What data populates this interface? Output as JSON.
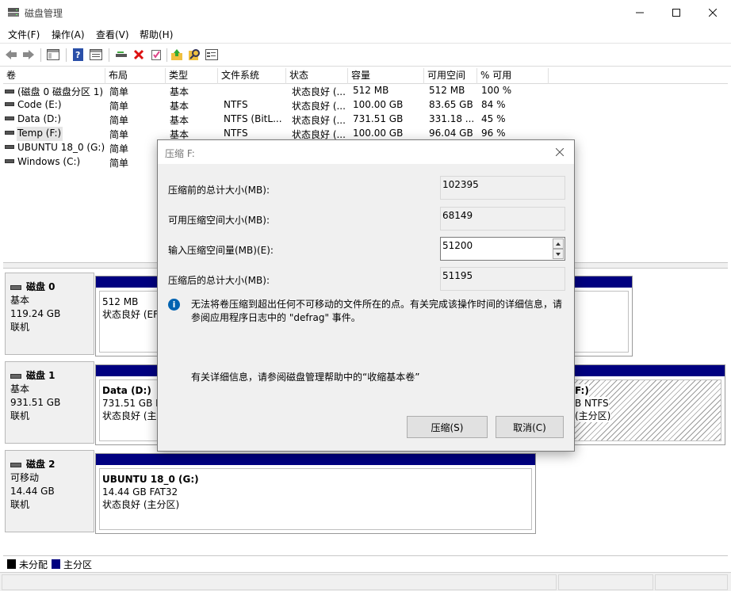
{
  "window": {
    "title": "磁盘管理"
  },
  "menu": [
    "文件(F)",
    "操作(A)",
    "查看(V)",
    "帮助(H)"
  ],
  "toolbar_icons": [
    "back-icon",
    "forward-icon",
    "console-tree-icon",
    "help-icon",
    "properties-icon",
    "connect-icon",
    "delete-icon",
    "check-icon",
    "import-icon",
    "search-icon",
    "settings-icon"
  ],
  "volume_list": {
    "columns": [
      "卷",
      "布局",
      "类型",
      "文件系统",
      "状态",
      "容量",
      "可用空间",
      "% 可用"
    ],
    "rows": [
      [
        "(磁盘 0 磁盘分区 1)",
        "简单",
        "基本",
        "",
        "状态良好 (...",
        "512 MB",
        "512 MB",
        "100 %"
      ],
      [
        "Code (E:)",
        "简单",
        "基本",
        "NTFS",
        "状态良好 (...",
        "100.00 GB",
        "83.65 GB",
        "84 %"
      ],
      [
        "Data (D:)",
        "简单",
        "基本",
        "NTFS (BitL...",
        "状态良好 (...",
        "731.51 GB",
        "331.18 ...",
        "45 %"
      ],
      [
        "Temp (F:)",
        "简单",
        "基本",
        "NTFS",
        "状态良好 (...",
        "100.00 GB",
        "96.04 GB",
        "96 %"
      ],
      [
        "UBUNTU 18_0 (G:)",
        "简单",
        "",
        "",
        "",
        "",
        "",
        ""
      ],
      [
        "Windows (C:)",
        "简单",
        "",
        "",
        "",
        "",
        "",
        ""
      ]
    ]
  },
  "disks": [
    {
      "name": "磁盘 0",
      "type": "基本",
      "size": "119.24 GB",
      "status": "联机",
      "partitions": [
        {
          "title": "",
          "line1": "512 MB",
          "line2": "状态良好 (EFI"
        }
      ]
    },
    {
      "name": "磁盘 1",
      "type": "基本",
      "size": "931.51 GB",
      "status": "联机",
      "partitions": [
        {
          "title": "Data  (D:)",
          "line1": "731.51 GB N",
          "line2": "状态良好 (主分"
        },
        {
          "title": "F:)",
          "line1": "B NTFS",
          "line2": "(主分区)"
        }
      ]
    },
    {
      "name": "磁盘 2",
      "type": "可移动",
      "size": "14.44 GB",
      "status": "联机",
      "partitions": [
        {
          "title": "UBUNTU 18_0  (G:)",
          "line1": "14.44 GB FAT32",
          "line2": "状态良好 (主分区)"
        }
      ]
    }
  ],
  "legend": [
    {
      "label": "未分配",
      "color": "#000000"
    },
    {
      "label": "主分区",
      "color": "#000080"
    }
  ],
  "dialog": {
    "title": "压缩 F:",
    "total_before_label": "压缩前的总计大小(MB):",
    "total_before_value": "102395",
    "available_label": "可用压缩空间大小(MB):",
    "available_value": "68149",
    "input_label": "输入压缩空间量(MB)(E):",
    "input_value": "51200",
    "total_after_label": "压缩后的总计大小(MB):",
    "total_after_value": "51195",
    "info_line1": "无法将卷压缩到超出任何不可移动的文件所在的点。有关完成该操作时间的详细信息，请",
    "info_line2": "参阅应用程序日志中的 \"defrag\" 事件。",
    "help_text": "有关详细信息，请参阅磁盘管理帮助中的“收缩基本卷”",
    "shrink_button": "压缩(S)",
    "cancel_button": "取消(C)"
  }
}
